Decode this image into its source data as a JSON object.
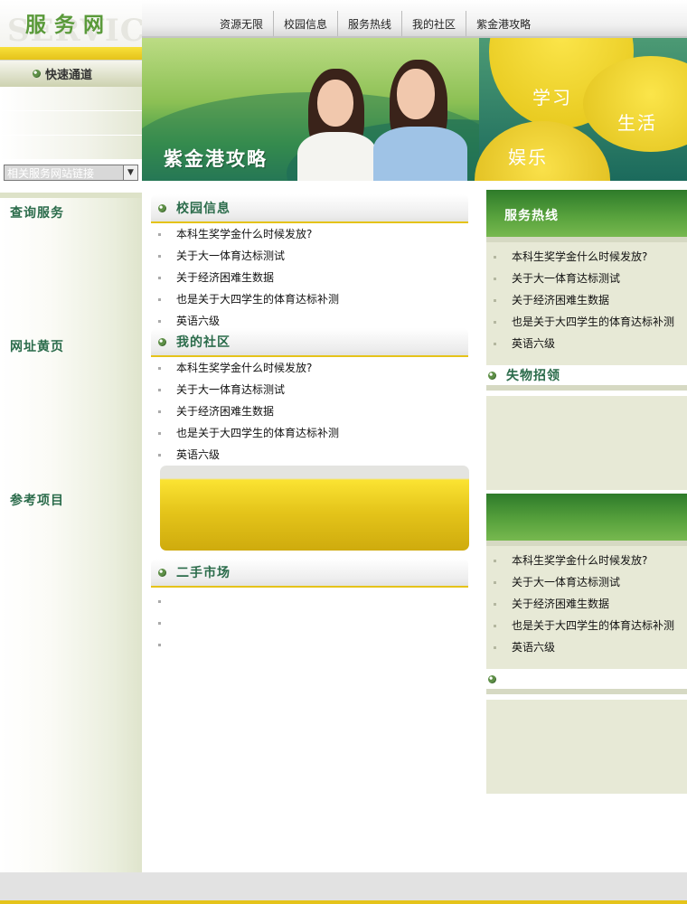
{
  "logo": {
    "title": "服务网",
    "watermark": "SERVICE"
  },
  "nav": {
    "items": [
      "资源无限",
      "校园信息",
      "服务热线",
      "我的社区",
      "紫金港攻略"
    ]
  },
  "banner": {
    "slogan": "紫金港攻略",
    "words": [
      "学习",
      "生活",
      "娱乐"
    ]
  },
  "sidebar": {
    "quick_title": "快速通道",
    "select_value": "相关服务网站链接",
    "sections": [
      "查询服务",
      "网址黄页",
      "参考项目"
    ]
  },
  "main": {
    "campus": {
      "title": "校园信息",
      "items": [
        "本科生奖学金什么时候发放?",
        "关于大一体育达标测试",
        "关于经济困难生数据",
        "也是关于大四学生的体育达标补测",
        "英语六级"
      ]
    },
    "community": {
      "title": "我的社区",
      "items": [
        "本科生奖学金什么时候发放?",
        "关于大一体育达标测试",
        "关于经济困难生数据",
        "也是关于大四学生的体育达标补测",
        "英语六级"
      ]
    },
    "market": {
      "title": "二手市场"
    }
  },
  "right": {
    "hotline": {
      "title": "服务热线",
      "items": [
        "本科生奖学金什么时候发放?",
        "关于大一体育达标测试",
        "关于经济困难生数据",
        "也是关于大四学生的体育达标补测",
        "英语六级"
      ]
    },
    "lostfound": {
      "title": "失物招领"
    },
    "box3": {
      "items": [
        "本科生奖学金什么时候发放?",
        "关于大一体育达标测试",
        "关于经济困难生数据",
        "也是关于大四学生的体育达标补测",
        "英语六级"
      ]
    }
  }
}
